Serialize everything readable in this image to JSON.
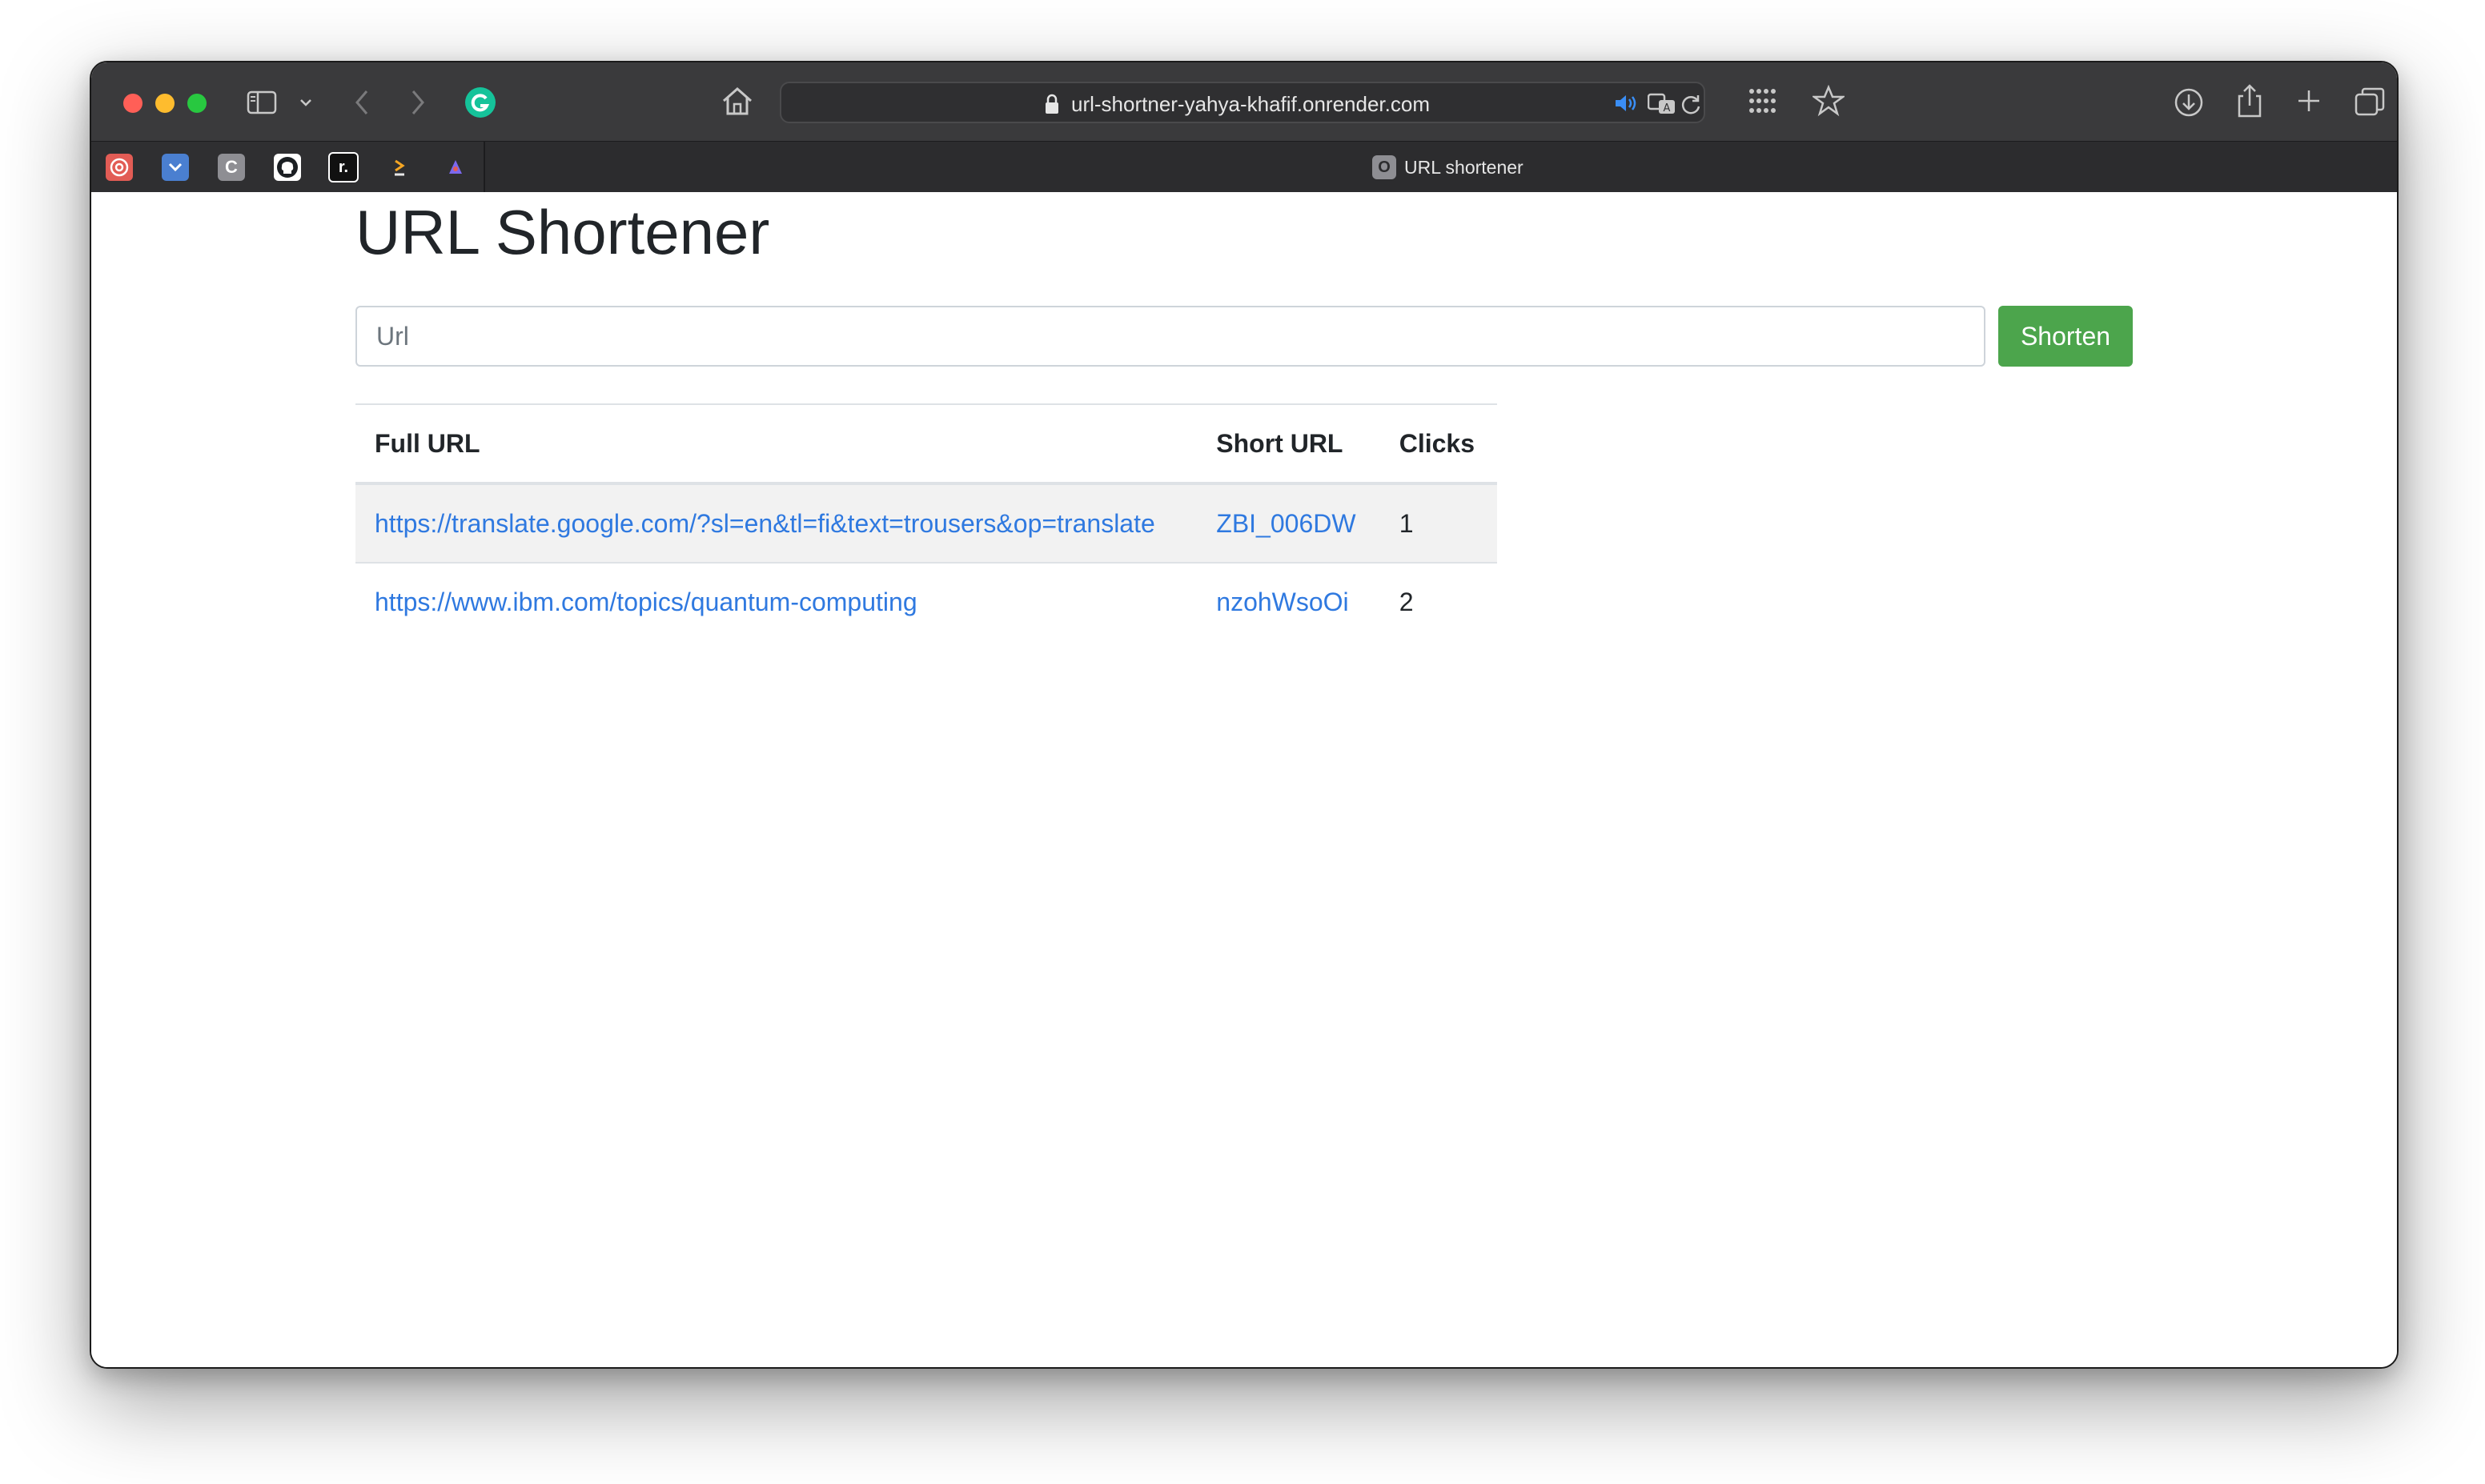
{
  "browser": {
    "address": "url-shortner-yahya-khafif.onrender.com",
    "active_tab_title": "URL shortener",
    "active_tab_icon_letter": "O",
    "favorites": [
      {
        "icon": "openai-icon",
        "color": "#e25c55"
      },
      {
        "icon": "pocket-icon",
        "color": "#4a7fd0"
      },
      {
        "icon": "c-icon",
        "color": "#8e8e93",
        "letter": "C"
      },
      {
        "icon": "github-icon",
        "color": "#ffffff"
      },
      {
        "icon": "r-icon",
        "color": "#ffffff",
        "letter": "r."
      },
      {
        "icon": "code-icon",
        "color": "#f5a623"
      },
      {
        "icon": "pen-icon",
        "color": "#7b68ee"
      }
    ]
  },
  "page": {
    "title": "URL Shortener",
    "input_placeholder": "Url",
    "shorten_label": "Shorten",
    "table": {
      "headers": [
        "Full URL",
        "Short URL",
        "Clicks"
      ],
      "rows": [
        {
          "full": "https://translate.google.com/?sl=en&tl=fi&text=trousers&op=translate",
          "short": "ZBI_006DW",
          "clicks": "1"
        },
        {
          "full": "https://www.ibm.com/topics/quantum-computing",
          "short": "nzohWsoOi",
          "clicks": "2"
        }
      ]
    }
  },
  "colors": {
    "accent_button": "#4ca54c",
    "link": "#2f79e0",
    "toolbar": "#3a3a3c"
  }
}
